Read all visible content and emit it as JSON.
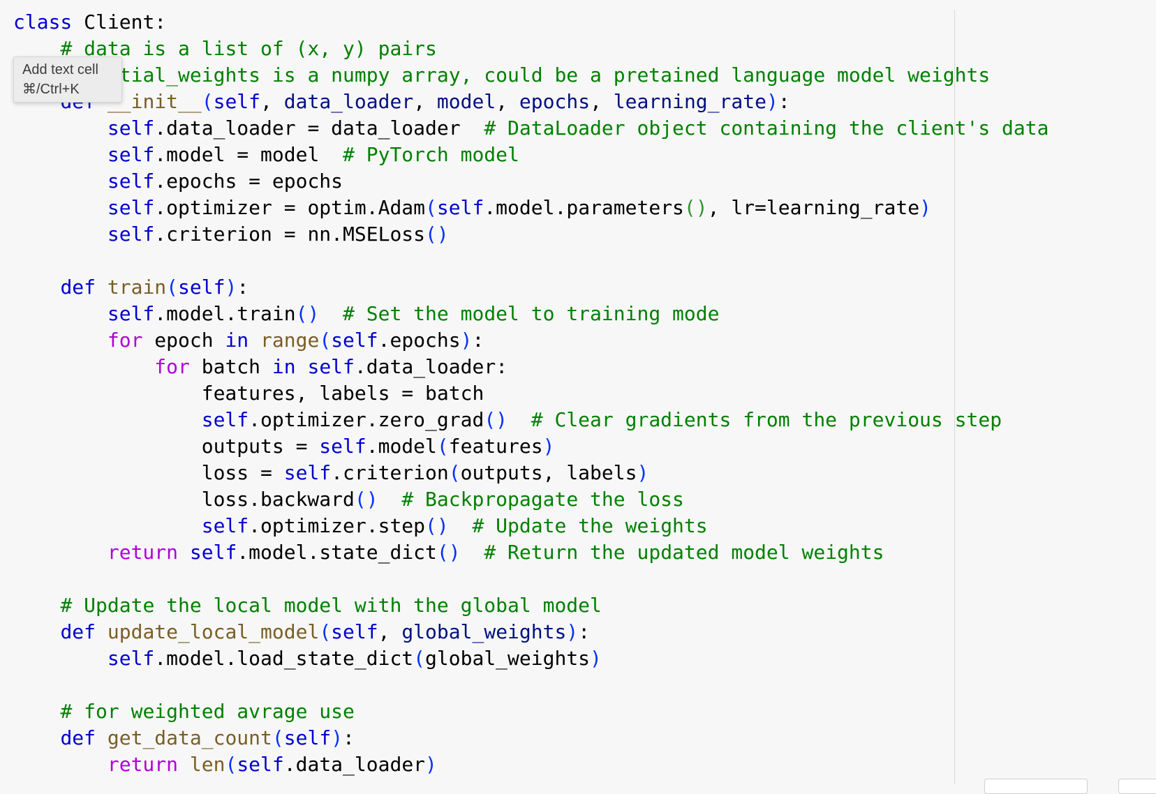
{
  "tooltip": {
    "title": "Add text cell",
    "shortcut": "⌘/Ctrl+K"
  },
  "colors": {
    "background": "#f7f7f7",
    "keyword": "#0000cf",
    "control": "#af00db",
    "comment": "#008000",
    "function": "#795e26",
    "parameter": "#001080",
    "paren": "#0431fa"
  },
  "code_lines": [
    [
      [
        "kw",
        "class"
      ],
      [
        "txt",
        " Client:"
      ]
    ],
    [
      [
        "txt",
        "    "
      ],
      [
        "cmt",
        "# data is a list of (x, y) pairs"
      ]
    ],
    [
      [
        "txt",
        "    "
      ],
      [
        "cmt",
        "# initial_weights is a numpy array, could be a pretained language model weights"
      ]
    ],
    [
      [
        "txt",
        "    "
      ],
      [
        "kw",
        "def"
      ],
      [
        "txt",
        " "
      ],
      [
        "fn",
        "__init__"
      ],
      [
        "pn",
        "("
      ],
      [
        "self",
        "self"
      ],
      [
        "txt",
        ", "
      ],
      [
        "par",
        "data_loader"
      ],
      [
        "txt",
        ", "
      ],
      [
        "par",
        "model"
      ],
      [
        "txt",
        ", "
      ],
      [
        "par",
        "epochs"
      ],
      [
        "txt",
        ", "
      ],
      [
        "par",
        "learning_rate"
      ],
      [
        "pn",
        ")"
      ],
      [
        "txt",
        ":"
      ]
    ],
    [
      [
        "txt",
        "        "
      ],
      [
        "self",
        "self"
      ],
      [
        "txt",
        ".data_loader = data_loader  "
      ],
      [
        "cmt",
        "# DataLoader object containing the client's data"
      ]
    ],
    [
      [
        "txt",
        "        "
      ],
      [
        "self",
        "self"
      ],
      [
        "txt",
        ".model = model  "
      ],
      [
        "cmt",
        "# PyTorch model"
      ]
    ],
    [
      [
        "txt",
        "        "
      ],
      [
        "self",
        "self"
      ],
      [
        "txt",
        ".epochs = epochs"
      ]
    ],
    [
      [
        "txt",
        "        "
      ],
      [
        "self",
        "self"
      ],
      [
        "txt",
        ".optimizer = optim.Adam"
      ],
      [
        "pn",
        "("
      ],
      [
        "self",
        "self"
      ],
      [
        "txt",
        ".model.parameters"
      ],
      [
        "pr",
        "()"
      ],
      [
        "txt",
        ", lr=learning_rate"
      ],
      [
        "pn",
        ")"
      ]
    ],
    [
      [
        "txt",
        "        "
      ],
      [
        "self",
        "self"
      ],
      [
        "txt",
        ".criterion = nn.MSELoss"
      ],
      [
        "pn",
        "()"
      ]
    ],
    [
      [
        "txt",
        ""
      ]
    ],
    [
      [
        "txt",
        "    "
      ],
      [
        "kw",
        "def"
      ],
      [
        "txt",
        " "
      ],
      [
        "fn",
        "train"
      ],
      [
        "pn",
        "("
      ],
      [
        "self",
        "self"
      ],
      [
        "pn",
        ")"
      ],
      [
        "txt",
        ":"
      ]
    ],
    [
      [
        "txt",
        "        "
      ],
      [
        "self",
        "self"
      ],
      [
        "txt",
        ".model.train"
      ],
      [
        "pn",
        "()"
      ],
      [
        "txt",
        "  "
      ],
      [
        "cmt",
        "# Set the model to training mode"
      ]
    ],
    [
      [
        "txt",
        "        "
      ],
      [
        "ctl",
        "for"
      ],
      [
        "txt",
        " epoch "
      ],
      [
        "kw",
        "in"
      ],
      [
        "txt",
        " "
      ],
      [
        "fn",
        "range"
      ],
      [
        "pn",
        "("
      ],
      [
        "self",
        "self"
      ],
      [
        "txt",
        ".epochs"
      ],
      [
        "pn",
        ")"
      ],
      [
        "txt",
        ":"
      ]
    ],
    [
      [
        "txt",
        "            "
      ],
      [
        "ctl",
        "for"
      ],
      [
        "txt",
        " batch "
      ],
      [
        "kw",
        "in"
      ],
      [
        "txt",
        " "
      ],
      [
        "self",
        "self"
      ],
      [
        "txt",
        ".data_loader:"
      ]
    ],
    [
      [
        "txt",
        "                features, labels = batch"
      ]
    ],
    [
      [
        "txt",
        "                "
      ],
      [
        "self",
        "self"
      ],
      [
        "txt",
        ".optimizer.zero_grad"
      ],
      [
        "pn",
        "()"
      ],
      [
        "txt",
        "  "
      ],
      [
        "cmt",
        "# Clear gradients from the previous step"
      ]
    ],
    [
      [
        "txt",
        "                outputs = "
      ],
      [
        "self",
        "self"
      ],
      [
        "txt",
        ".model"
      ],
      [
        "pn",
        "("
      ],
      [
        "txt",
        "features"
      ],
      [
        "pn",
        ")"
      ]
    ],
    [
      [
        "txt",
        "                loss = "
      ],
      [
        "self",
        "self"
      ],
      [
        "txt",
        ".criterion"
      ],
      [
        "pn",
        "("
      ],
      [
        "txt",
        "outputs, labels"
      ],
      [
        "pn",
        ")"
      ]
    ],
    [
      [
        "txt",
        "                loss.backward"
      ],
      [
        "pn",
        "()"
      ],
      [
        "txt",
        "  "
      ],
      [
        "cmt",
        "# Backpropagate the loss"
      ]
    ],
    [
      [
        "txt",
        "                "
      ],
      [
        "self",
        "self"
      ],
      [
        "txt",
        ".optimizer.step"
      ],
      [
        "pn",
        "()"
      ],
      [
        "txt",
        "  "
      ],
      [
        "cmt",
        "# Update the weights"
      ]
    ],
    [
      [
        "txt",
        "        "
      ],
      [
        "ctl",
        "return"
      ],
      [
        "txt",
        " "
      ],
      [
        "self",
        "self"
      ],
      [
        "txt",
        ".model.state_dict"
      ],
      [
        "pn",
        "()"
      ],
      [
        "txt",
        "  "
      ],
      [
        "cmt",
        "# Return the updated model weights"
      ]
    ],
    [
      [
        "txt",
        ""
      ]
    ],
    [
      [
        "txt",
        "    "
      ],
      [
        "cmt",
        "# Update the local model with the global model"
      ]
    ],
    [
      [
        "txt",
        "    "
      ],
      [
        "kw",
        "def"
      ],
      [
        "txt",
        " "
      ],
      [
        "fn",
        "update_local_model"
      ],
      [
        "pn",
        "("
      ],
      [
        "self",
        "self"
      ],
      [
        "txt",
        ", "
      ],
      [
        "par",
        "global_weights"
      ],
      [
        "pn",
        ")"
      ],
      [
        "txt",
        ":"
      ]
    ],
    [
      [
        "txt",
        "        "
      ],
      [
        "self",
        "self"
      ],
      [
        "txt",
        ".model.load_state_dict"
      ],
      [
        "pn",
        "("
      ],
      [
        "txt",
        "global_weights"
      ],
      [
        "pn",
        ")"
      ]
    ],
    [
      [
        "txt",
        ""
      ]
    ],
    [
      [
        "txt",
        "    "
      ],
      [
        "cmt",
        "# for weighted avrage use"
      ]
    ],
    [
      [
        "txt",
        "    "
      ],
      [
        "kw",
        "def"
      ],
      [
        "txt",
        " "
      ],
      [
        "fn",
        "get_data_count"
      ],
      [
        "pn",
        "("
      ],
      [
        "self",
        "self"
      ],
      [
        "pn",
        ")"
      ],
      [
        "txt",
        ":"
      ]
    ],
    [
      [
        "txt",
        "        "
      ],
      [
        "ctl",
        "return"
      ],
      [
        "txt",
        " "
      ],
      [
        "fn",
        "len"
      ],
      [
        "pn",
        "("
      ],
      [
        "self",
        "self"
      ],
      [
        "txt",
        ".data_loader"
      ],
      [
        "pn",
        ")"
      ]
    ]
  ]
}
